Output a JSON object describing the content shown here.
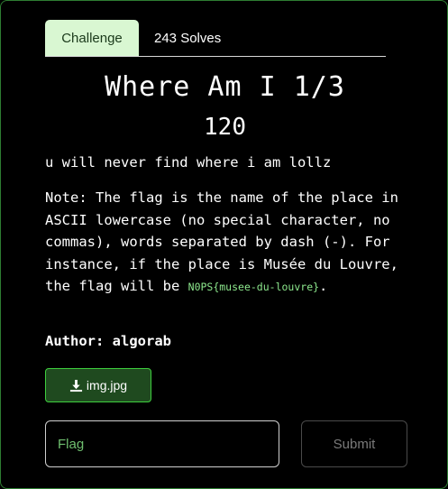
{
  "tabs": {
    "challenge": "Challenge",
    "solves": "243 Solves"
  },
  "challenge": {
    "name": "Where Am I 1/3",
    "value": "120",
    "description_line": "u will never find where i am lollz",
    "note_text": "Note: The flag is the name of the place in ASCII lowercase (no special character, no commas), words separated by dash (-). For instance, if the place is Musée du Louvre, the flag will be ",
    "note_flag_example": "N0PS{musee-du-louvre}",
    "note_end": ".",
    "author": "Author: algorab"
  },
  "file": {
    "label": "img.jpg",
    "icon": "download-icon"
  },
  "form": {
    "placeholder": "Flag",
    "submit_label": "Submit"
  },
  "colors": {
    "accent": "#3ecf3e",
    "tab_active_bg": "#d9f7d2",
    "flag_code": "#8de88d"
  }
}
